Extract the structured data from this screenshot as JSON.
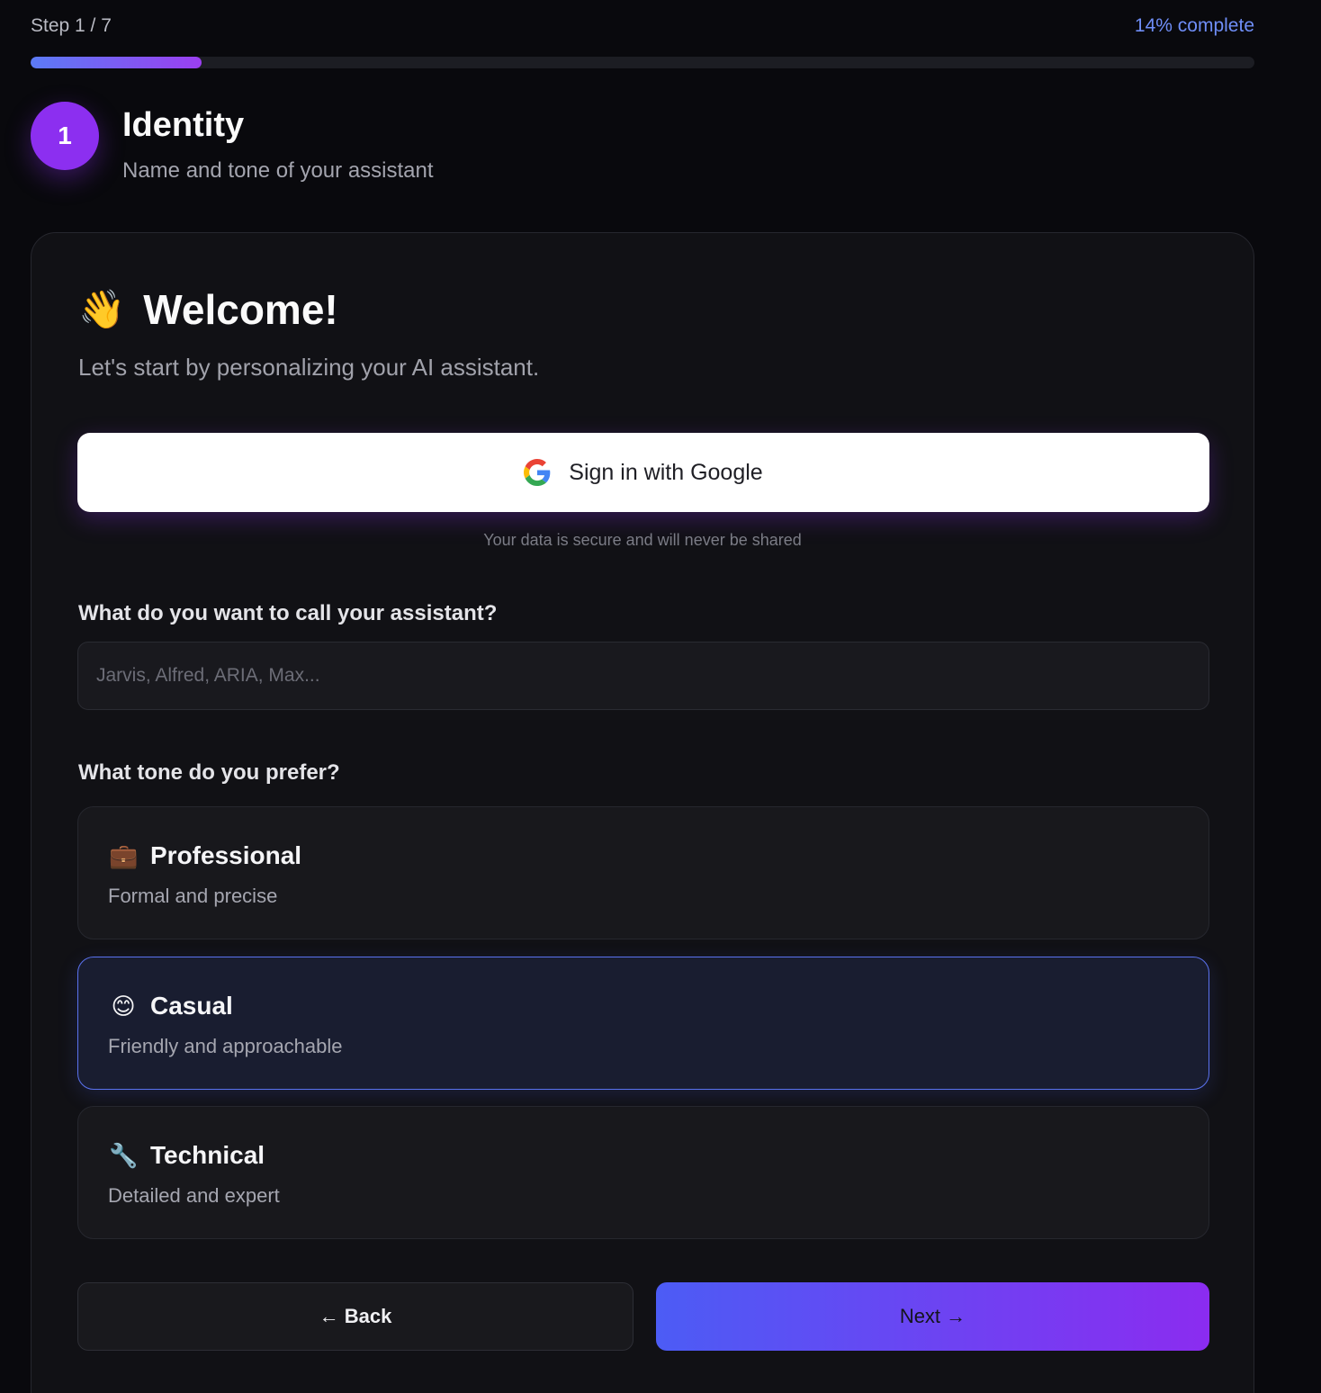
{
  "progress": {
    "step_text": "Step 1 / 7",
    "percent_text": "14% complete",
    "fraction": 0.14
  },
  "step": {
    "number": "1",
    "title": "Identity",
    "subtitle": "Name and tone of your assistant"
  },
  "welcome": {
    "icon": "waving-hand-icon",
    "emoji": "👋",
    "title": "Welcome!",
    "subtitle": "Let's start by personalizing your AI assistant."
  },
  "google": {
    "label": "Sign in with Google",
    "note": "Your data is secure and will never be shared"
  },
  "name_field": {
    "label": "What do you want to call your assistant?",
    "placeholder": "Jarvis, Alfred, ARIA, Max...",
    "value": ""
  },
  "tone": {
    "label": "What tone do you prefer?",
    "options": [
      {
        "icon": "briefcase-icon",
        "emoji": "💼",
        "title": "Professional",
        "description": "Formal and precise",
        "selected": false
      },
      {
        "icon": "smiling-face-icon",
        "emoji": "😊",
        "title": "Casual",
        "description": "Friendly and approachable",
        "selected": true
      },
      {
        "icon": "wrench-icon",
        "emoji": "🔧",
        "title": "Technical",
        "description": "Detailed and expert",
        "selected": false
      }
    ]
  },
  "nav": {
    "back_label": "← Back",
    "next_label": "Next →"
  },
  "colors": {
    "accent_purple": "#8c2ff0",
    "accent_blue": "#4c5cf5",
    "progress_text": "#6f8ef7",
    "selected_border": "#5a72ee"
  }
}
